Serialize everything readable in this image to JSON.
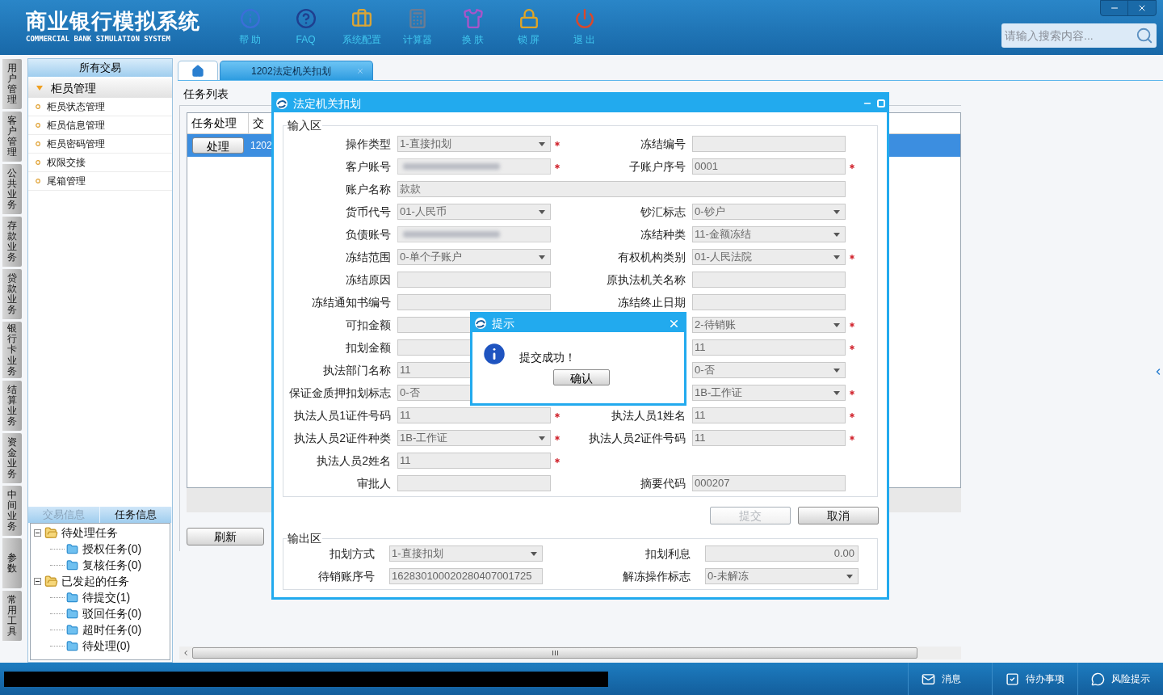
{
  "header": {
    "title": "商业银行模拟系统",
    "subtitle": "COMMERCIAL BANK SIMULATION SYSTEM",
    "window_controls": [
      {
        "kind": "minimize"
      },
      {
        "kind": "close"
      }
    ],
    "nav": [
      {
        "kind": "info",
        "label": "帮 助"
      },
      {
        "kind": "faq",
        "label": "FAQ"
      },
      {
        "kind": "config",
        "label": "系统配置"
      },
      {
        "kind": "calculator",
        "label": "计算器"
      },
      {
        "kind": "skin",
        "label": "换 肤"
      },
      {
        "kind": "lock",
        "label": "锁 屏"
      },
      {
        "kind": "exit",
        "label": "退 出"
      }
    ],
    "search": {
      "placeholder": "请输入搜索内容..."
    }
  },
  "module_tabs": [
    "用户管理",
    "客户管理",
    "公共业务",
    "存款业务",
    "贷款业务",
    "银行卡业务",
    "结算业务",
    "资金业务",
    "中间业务",
    "参数",
    "常用工具"
  ],
  "side_panel": {
    "header": "所有交易",
    "group": {
      "label": "柜员管理",
      "expanded": true,
      "items": [
        "柜员状态管理",
        "柜员信息管理",
        "柜员密码管理",
        "权限交接",
        "尾箱管理"
      ]
    },
    "bottom_tabs": [
      {
        "label": "交易信息",
        "selected": false
      },
      {
        "label": "任务信息",
        "selected": true
      }
    ],
    "task_tree": [
      {
        "label": "待处理任务",
        "expanded": true,
        "children": [
          {
            "label": "授权任务(0)"
          },
          {
            "label": "复核任务(0)"
          }
        ]
      },
      {
        "label": "已发起的任务",
        "expanded": true,
        "children": [
          {
            "label": "待提交(1)"
          },
          {
            "label": "驳回任务(0)"
          },
          {
            "label": "超时任务(0)"
          },
          {
            "label": "待处理(0)"
          }
        ]
      }
    ]
  },
  "tabs": [
    {
      "kind": "home",
      "selected": false
    },
    {
      "kind": "text",
      "label": "1202法定机关扣划",
      "selected": true
    }
  ],
  "task_list": {
    "title": "任务列表",
    "columns": [
      "任务处理",
      "交"
    ],
    "rows": [
      {
        "selected": true,
        "action": "处理",
        "cell": "1202"
      }
    ],
    "refresh": "刷新"
  },
  "dialog": {
    "title": "法定机关扣划",
    "input_section": {
      "legend": "输入区",
      "rows": [
        {
          "left": {
            "label": "操作类型",
            "kind": "select",
            "value": "1-直接扣划",
            "required": true
          },
          "right": {
            "label": "冻结编号",
            "kind": "text",
            "required": false
          }
        },
        {
          "left": {
            "label": "客户账号",
            "kind": "blurred",
            "required": true
          },
          "right": {
            "label": "子账户序号",
            "kind": "text",
            "value": "0001",
            "required": true
          }
        },
        {
          "wide": {
            "label": "账户名称",
            "kind": "text",
            "value": "款款",
            "required": false
          }
        },
        {
          "left": {
            "label": "货币代号",
            "kind": "select",
            "value": "01-人民币",
            "required": false
          },
          "right": {
            "label": "钞汇标志",
            "kind": "select",
            "value": "0-钞户",
            "required": false
          }
        },
        {
          "left": {
            "label": "负债账号",
            "kind": "blurred",
            "required": false
          },
          "right": {
            "label": "冻结种类",
            "kind": "select",
            "value": "11-金额冻结",
            "required": false
          }
        },
        {
          "left": {
            "label": "冻结范围",
            "kind": "select",
            "value": "0-单个子账户",
            "required": false
          },
          "right": {
            "label": "有权机构类别",
            "kind": "select",
            "value": "01-人民法院",
            "required": true
          }
        },
        {
          "left": {
            "label": "冻结原因",
            "kind": "text",
            "required": false
          },
          "right": {
            "label": "原执法机关名称",
            "kind": "text",
            "required": false
          }
        },
        {
          "left": {
            "label": "冻结通知书编号",
            "kind": "text",
            "required": false
          },
          "right": {
            "label": "冻结终止日期",
            "kind": "text",
            "required": false
          }
        },
        {
          "left": {
            "label": "可扣金额",
            "kind": "text",
            "required": false
          },
          "right": {
            "kind": "select",
            "value": "2-待销账",
            "required": true
          }
        },
        {
          "left": {
            "label": "扣划金额",
            "kind": "text",
            "required": false
          },
          "right": {
            "kind": "text",
            "value": "11",
            "required": true
          }
        },
        {
          "left": {
            "label": "执法部门名称",
            "kind": "text",
            "value": "11",
            "required": false
          },
          "right": {
            "kind": "select",
            "value": "0-否",
            "required": false
          }
        },
        {
          "left": {
            "label": "保证金质押扣划标志",
            "kind": "text",
            "value": "0-否",
            "required": false
          },
          "right": {
            "kind": "select",
            "value": "1B-工作证",
            "required": true
          }
        },
        {
          "left": {
            "label": "执法人员1证件号码",
            "kind": "text",
            "value": "11",
            "required": true
          },
          "right": {
            "label": "执法人员1姓名",
            "kind": "text",
            "value": "11",
            "required": true
          }
        },
        {
          "left": {
            "label": "执法人员2证件种类",
            "kind": "select",
            "value": "1B-工作证",
            "required": true
          },
          "right": {
            "label": "执法人员2证件号码",
            "kind": "text",
            "value": "11",
            "required": true
          }
        },
        {
          "left": {
            "label": "执法人员2姓名",
            "kind": "text",
            "value": "11",
            "required": true
          }
        },
        {
          "left": {
            "label": "审批人",
            "kind": "text",
            "required": false
          },
          "right": {
            "label": "摘要代码",
            "kind": "text",
            "value": "000207",
            "required": false
          }
        }
      ]
    },
    "buttons": [
      {
        "label": "提交",
        "disabled": true
      },
      {
        "label": "取消",
        "disabled": false
      }
    ],
    "output_section": {
      "legend": "输出区",
      "rows": [
        {
          "left": {
            "label": "扣划方式",
            "kind": "select",
            "value": "1-直接扣划",
            "required": false
          },
          "right": {
            "label": "扣划利息",
            "kind": "number",
            "value": "0.00",
            "required": false
          }
        },
        {
          "left": {
            "label": "待销账序号",
            "kind": "text",
            "value": "162830100020280407001725",
            "required": false
          },
          "right": {
            "label": "解冻操作标志",
            "kind": "select",
            "value": "0-未解冻",
            "required": false
          }
        }
      ]
    }
  },
  "prompt": {
    "title": "提示",
    "message": "提交成功！",
    "button": "确认"
  },
  "status_bar": {
    "items": [
      {
        "kind": "message",
        "label": "消息"
      },
      {
        "kind": "todo",
        "label": "待办事项"
      },
      {
        "kind": "risk",
        "label": "风险提示"
      }
    ]
  }
}
